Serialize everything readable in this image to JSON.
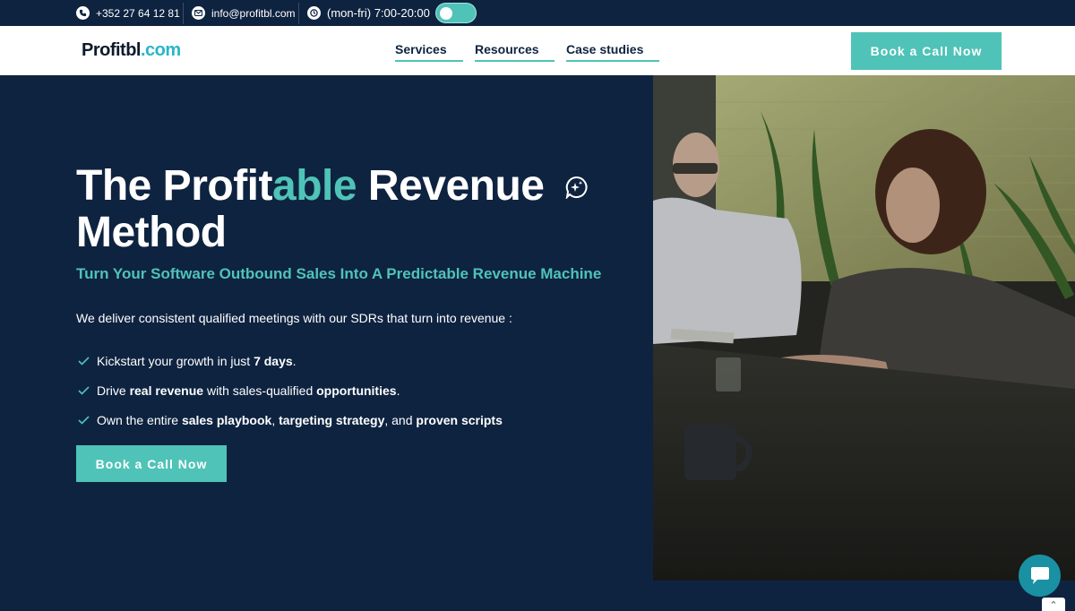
{
  "topbar": {
    "phone": "+352 27 64 12 81",
    "email": "info@profitbl.com",
    "hours": "(mon-fri) 7:00-20:00"
  },
  "header": {
    "logo_main": "Profitbl",
    "logo_suffix": ".com",
    "nav": [
      "Services",
      "Resources",
      "Case studies"
    ],
    "cta": "Book a Call Now"
  },
  "hero": {
    "title_part1": "The Profit",
    "title_accent": "able",
    "title_part2": " Revenue Method",
    "subtitle": "Turn Your Software Outbound Sales Into A Predictable Revenue Machine",
    "lead": "We deliver consistent qualified meetings with our SDRs that turn into revenue :",
    "bullets": [
      {
        "a": "Kickstart your growth in just ",
        "b": "7 days",
        "c": "."
      },
      {
        "a": "Drive ",
        "b": "real revenue",
        "c": " with sales-qualified ",
        "d": "opportunities",
        "e": "."
      },
      {
        "a": "Own the entire ",
        "b": "sales playbook",
        "c": ", ",
        "d": "targeting strategy",
        "e": ", and ",
        "f": "proven scripts"
      }
    ],
    "cta": "Book a Call Now"
  },
  "colors": {
    "navy": "#0e2340",
    "accent": "#4fc3b7",
    "logo_accent": "#29b6c9",
    "chat": "#1a90a3"
  },
  "icons": [
    "phone-icon",
    "mail-icon",
    "clock-icon",
    "check-icon",
    "chat-spark-icon",
    "chat-icon",
    "chevron-up-icon"
  ]
}
